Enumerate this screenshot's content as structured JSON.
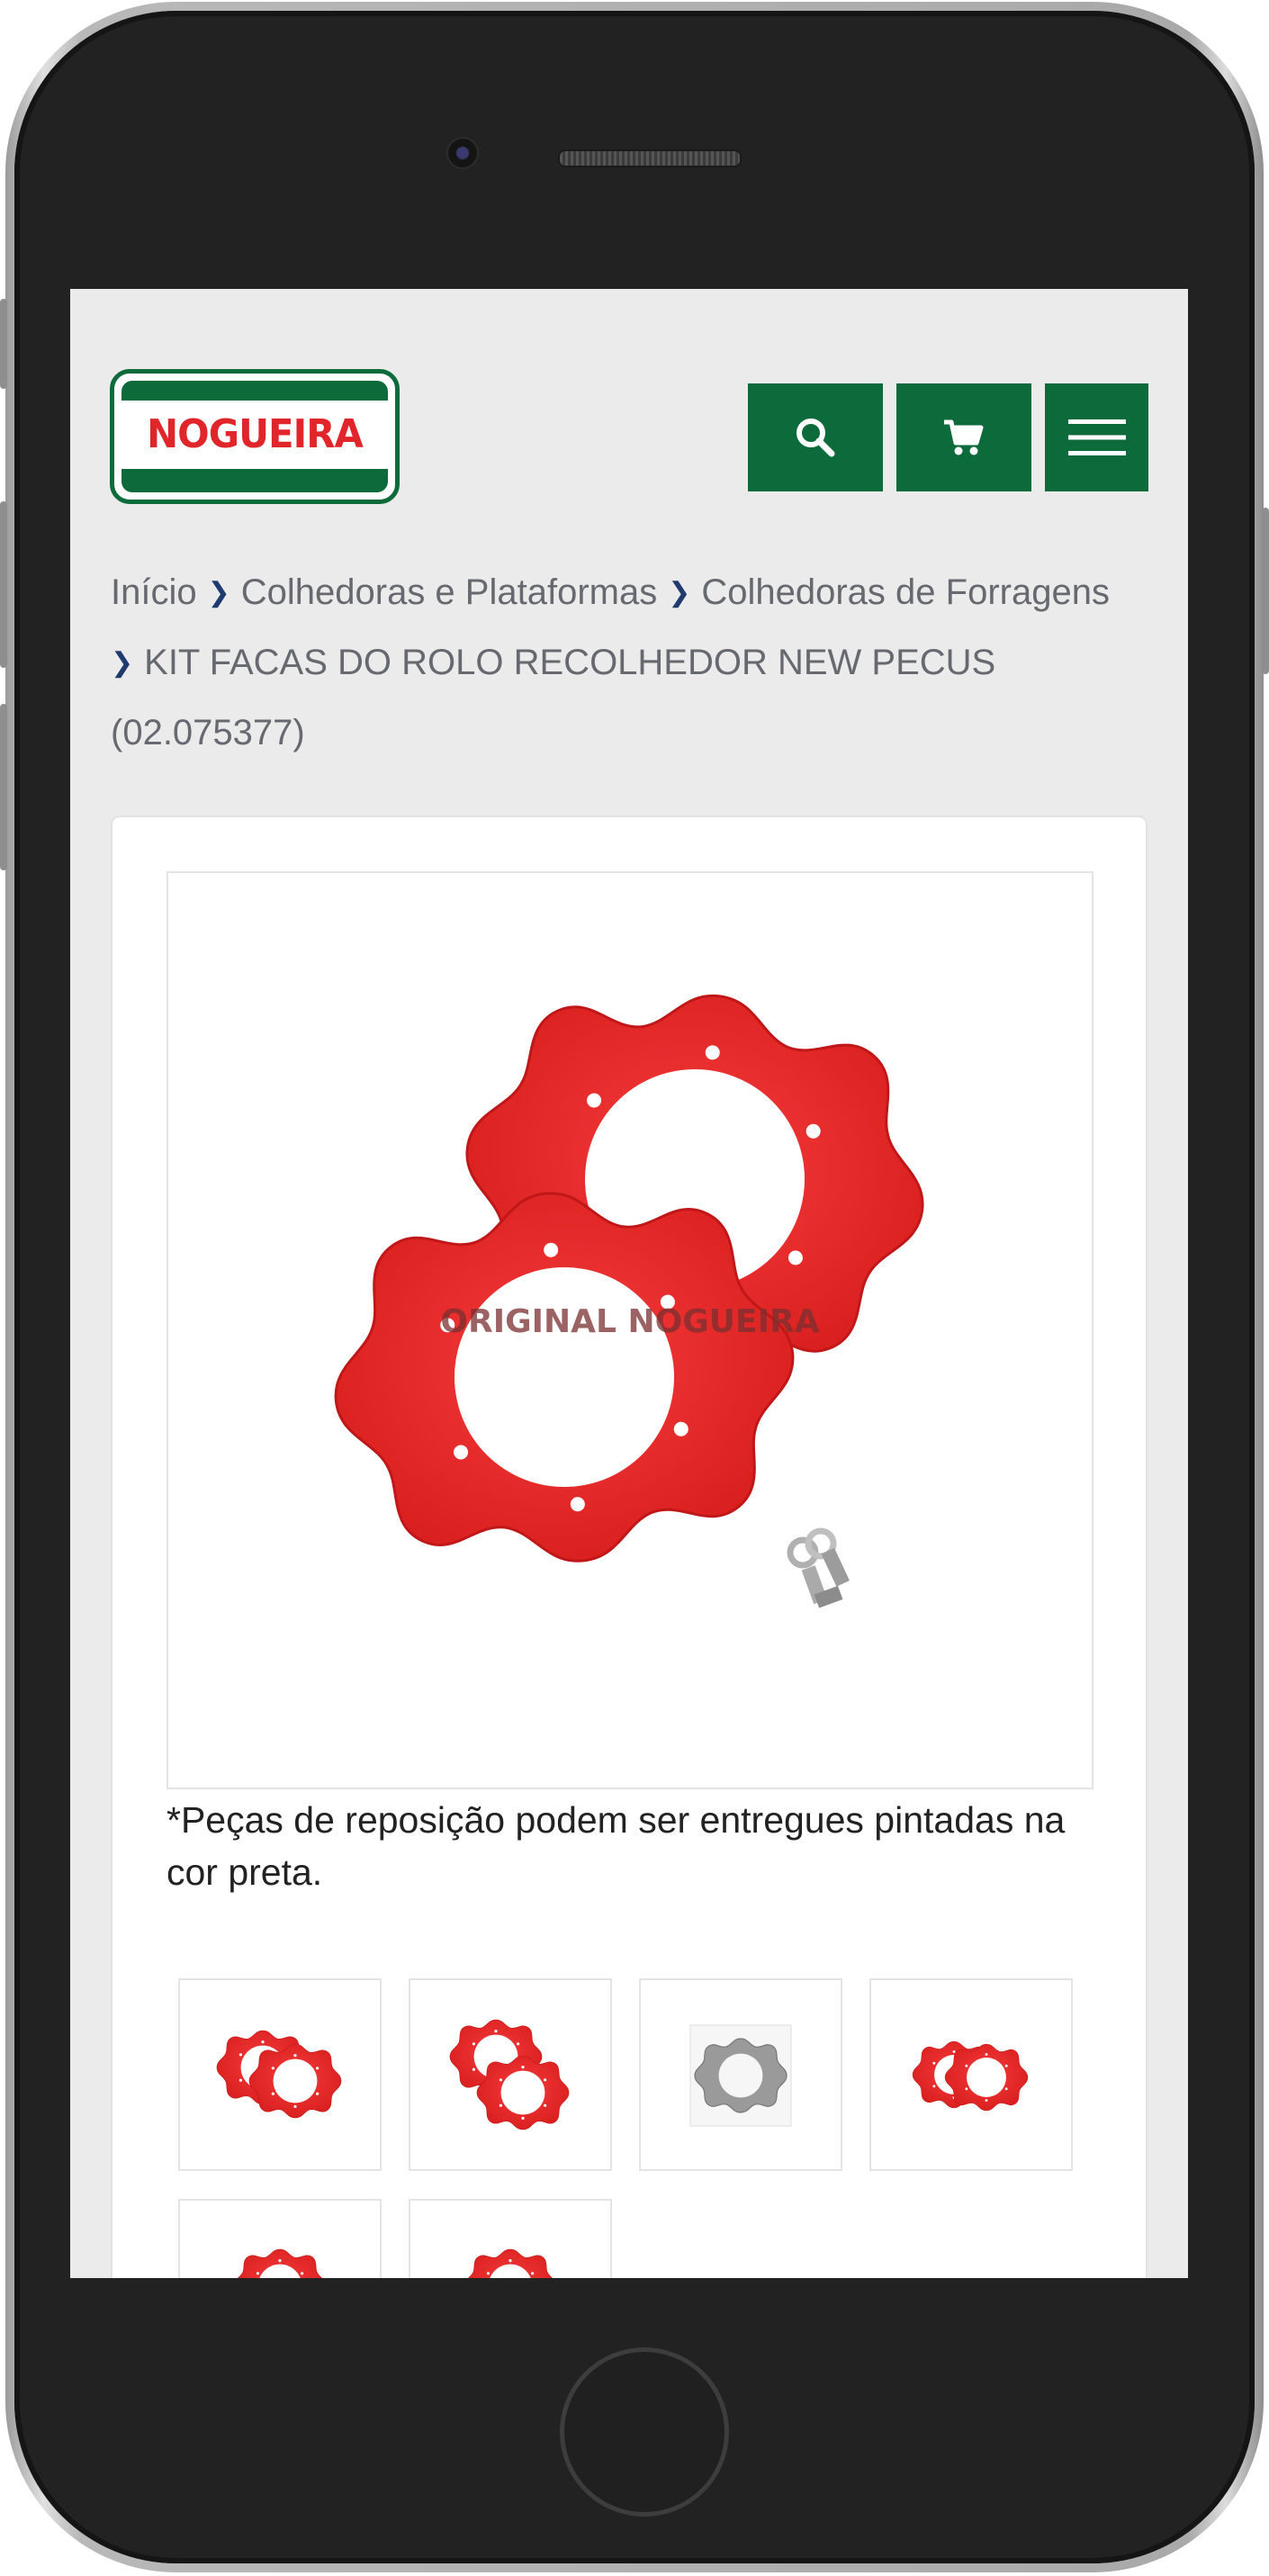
{
  "header": {
    "logo_text": "NOGUEIRA",
    "search_icon": "search-icon",
    "cart_icon": "cart-icon",
    "menu_icon": "hamburger-menu-icon"
  },
  "breadcrumb": {
    "items": [
      "Início",
      "Colhedoras e Plataformas",
      "Colhedoras de Forragens",
      "KIT FACAS DO ROLO RECOLHEDOR NEW PECUS (02.075377)"
    ]
  },
  "product": {
    "watermark": "ORIGINAL NOGUEIRA",
    "note": "*Peças de reposição podem ser entregues pintadas na cor preta."
  },
  "colors": {
    "brand_green": "#0d6b3b",
    "brand_red": "#e0262b",
    "part_red": "#ee2a2a"
  }
}
